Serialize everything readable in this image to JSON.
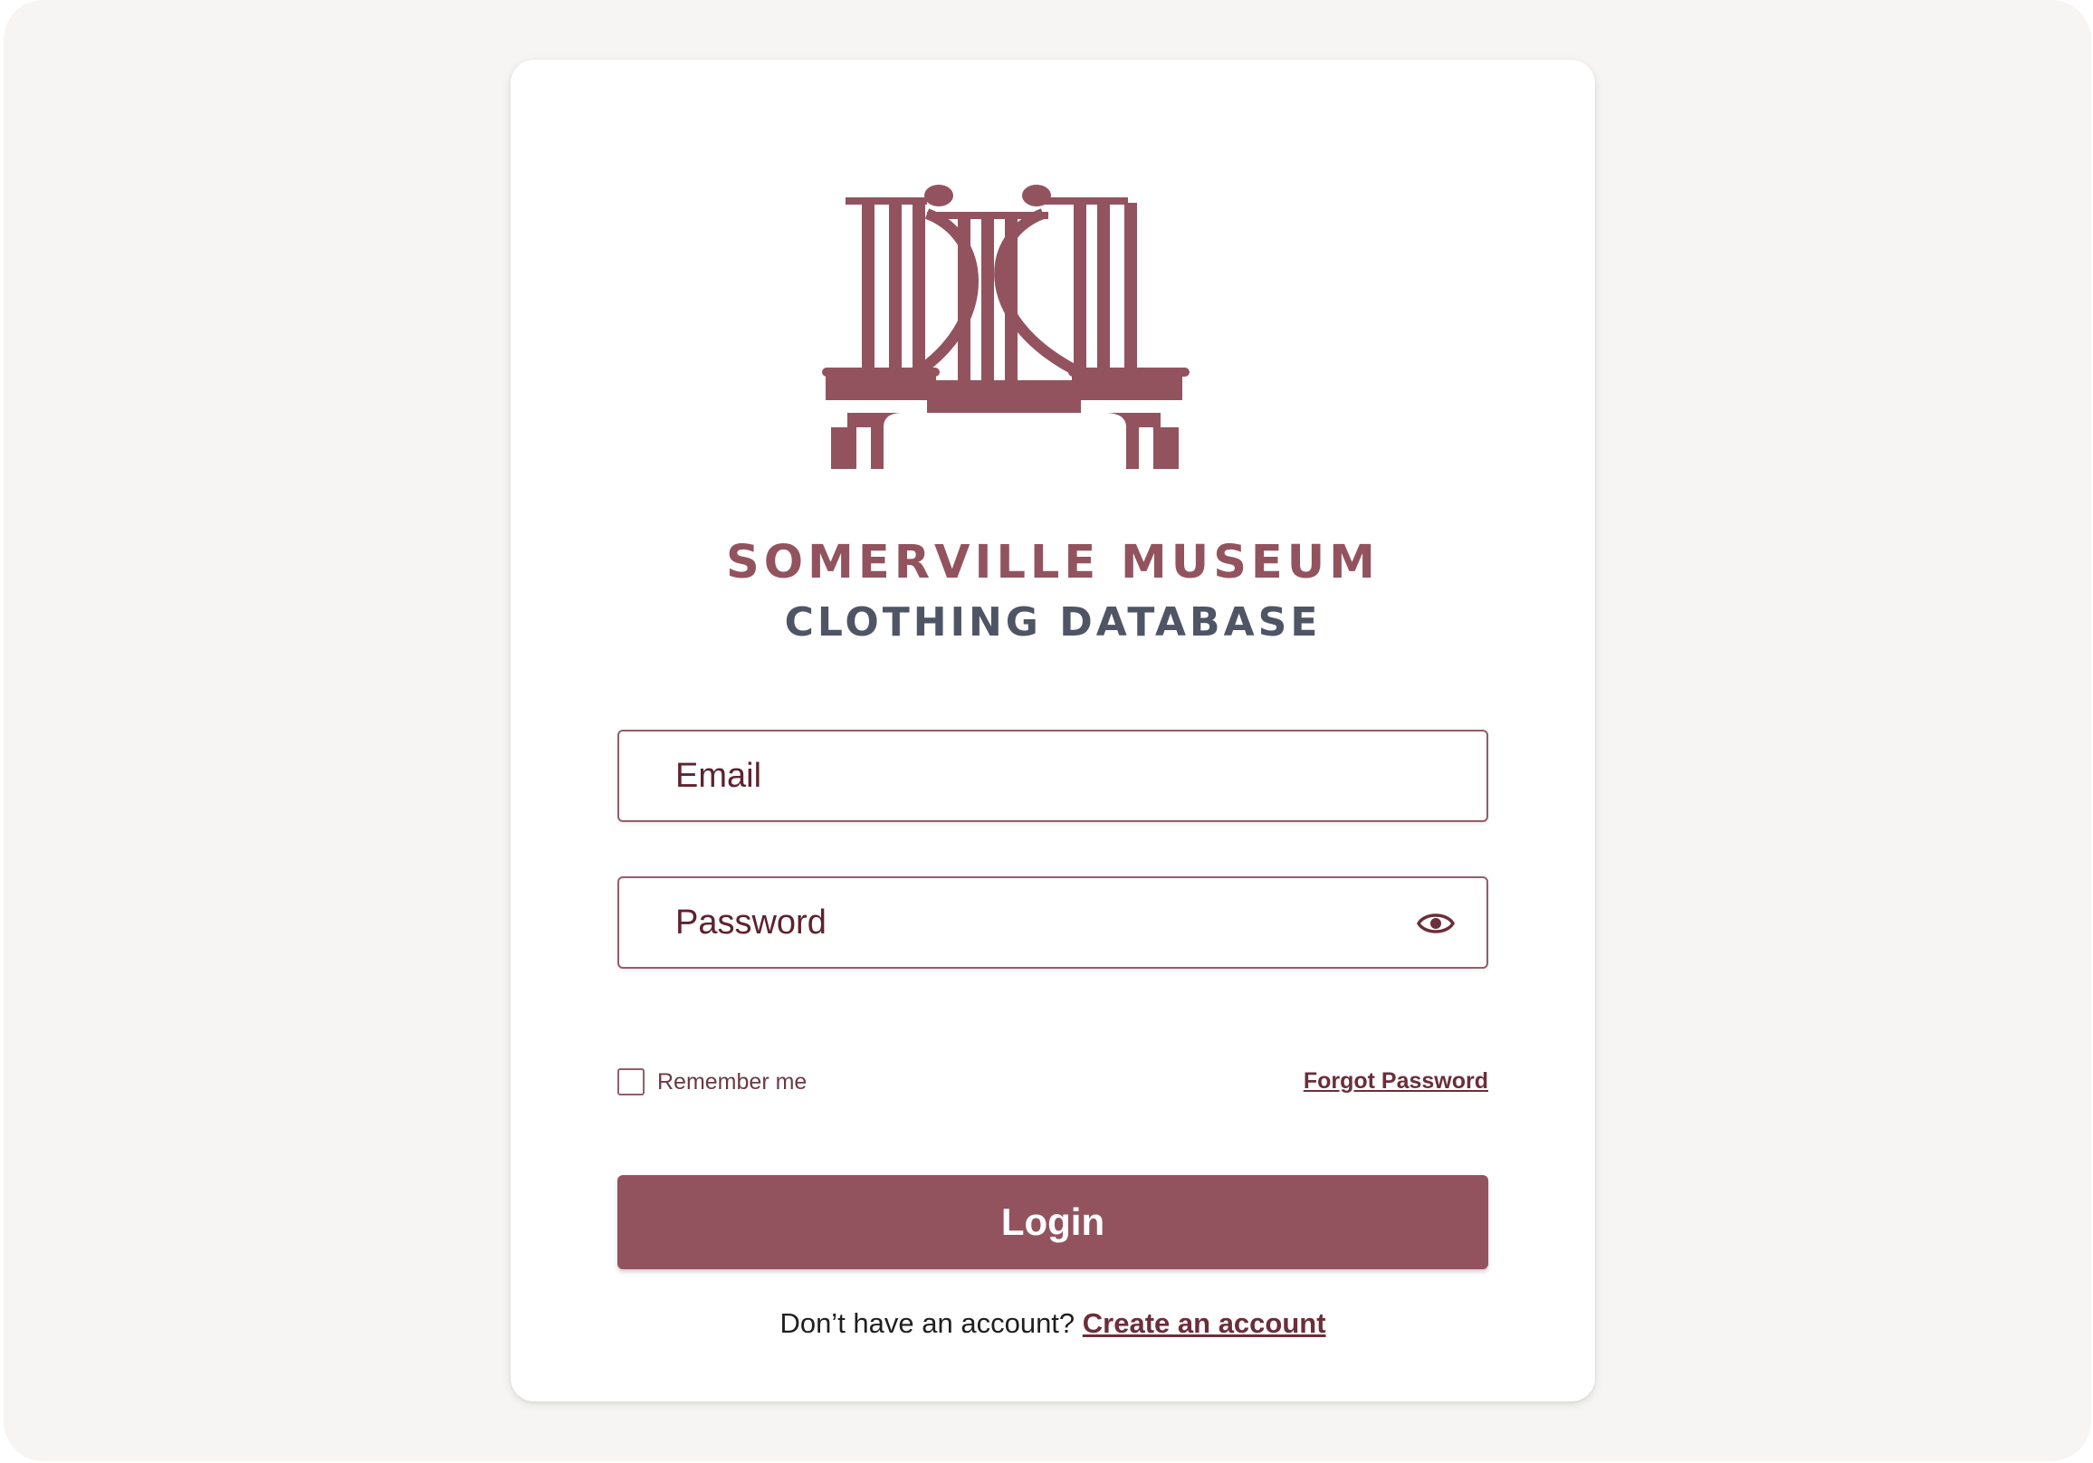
{
  "brand": {
    "name_line1": "SOMERVILLE MUSEUM",
    "name_line2": "CLOTHING DATABASE",
    "primary_color": "#92535f",
    "secondary_color": "#4f5565"
  },
  "form": {
    "email_placeholder": "Email",
    "password_placeholder": "Password",
    "password_toggle_icon": "eye-icon",
    "remember_label": "Remember me",
    "remember_checked": false,
    "forgot_label": "Forgot Password",
    "login_label": "Login",
    "signup_prompt": "Don’t have an account?",
    "signup_link": "Create an account"
  }
}
